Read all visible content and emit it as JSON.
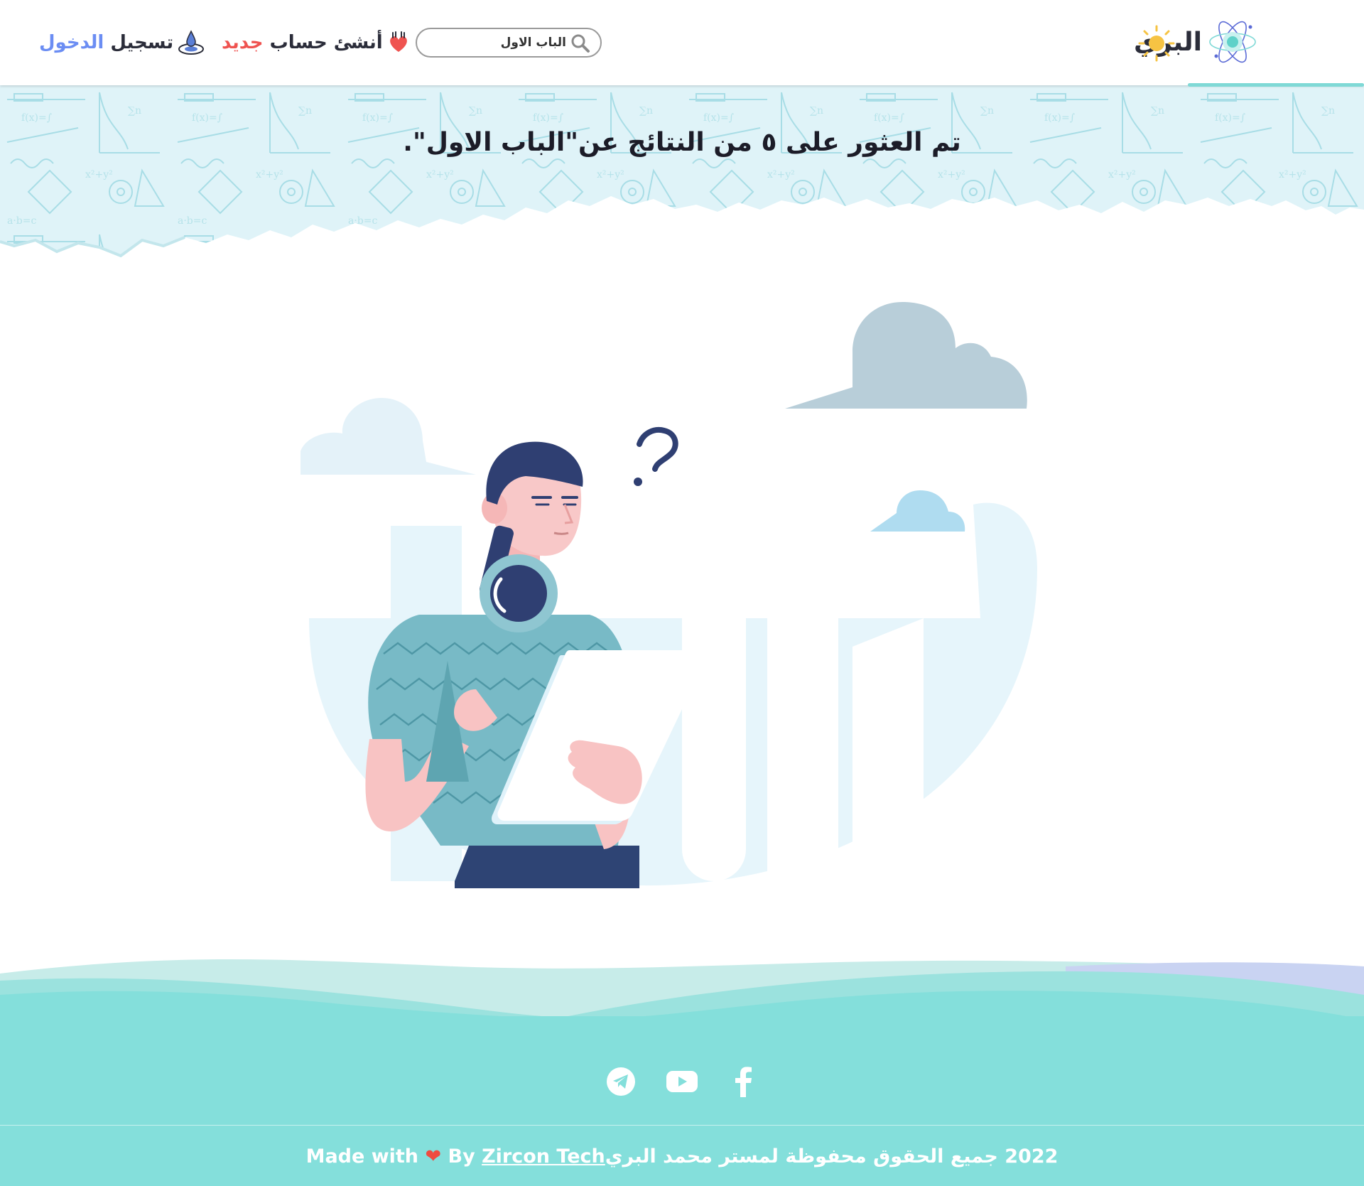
{
  "header": {
    "brand_name": "البري",
    "search": {
      "value": "الباب الاول"
    },
    "register": {
      "prefix": "أنشئ حساب ",
      "accent": "جديد"
    },
    "login": {
      "prefix": "تسجيل ",
      "accent": "الدخول"
    }
  },
  "hero": {
    "title": "تم العثور على ٥ من النتائج عن\"الباب الاول\"."
  },
  "footer": {
    "social": [
      "telegram-icon",
      "youtube-icon",
      "facebook-icon"
    ],
    "made_with": "Made with",
    "heart": "❤",
    "by": "By",
    "company": "Zircon Tech",
    "copyright": "2022 جميع الحقوق محفوظة لمستر محمد البري"
  },
  "colors": {
    "accent_teal": "#84dfdb",
    "accent_red": "#ef5350",
    "accent_blue": "#6b8df3",
    "sun_yellow": "#f6c343",
    "text_dark": "#2b2d3a"
  }
}
